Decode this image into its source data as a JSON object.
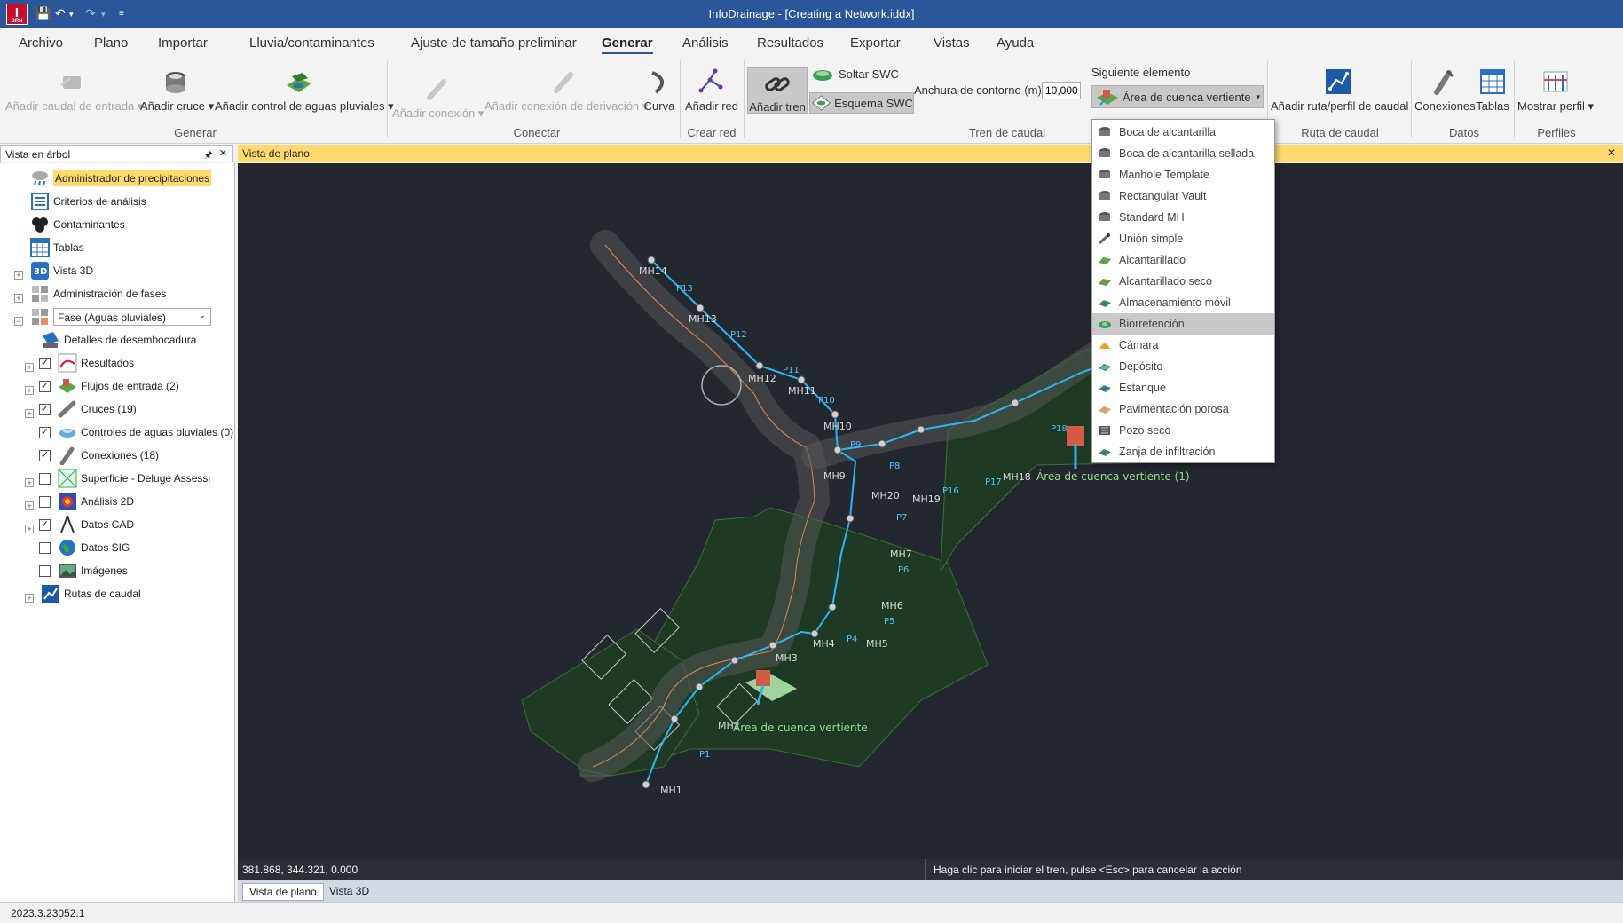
{
  "window": {
    "title": "InfoDrainage - [Creating a Network.iddx]",
    "logo_letter": "I",
    "logo_sub": "DRN"
  },
  "menu": {
    "tabs": [
      "Archivo",
      "Plano",
      "Importar",
      "Lluvia/contaminantes",
      "Ajuste de tamaño preliminar",
      "Generar",
      "Análisis",
      "Resultados",
      "Exportar",
      "Vistas",
      "Ayuda"
    ],
    "active": "Generar"
  },
  "ribbon": {
    "generar": {
      "label": "Generar",
      "add_inflow": "Añadir caudal de entrada",
      "add_junction": "Añadir cruce",
      "add_stormwater_control": "Añadir control de aguas pluviales"
    },
    "conectar": {
      "label": "Conectar",
      "add_connection": "Añadir conexión",
      "add_branch_connection": "Añadir conexión de derivación",
      "curve": "Curva"
    },
    "crear_red": {
      "label": "Crear red",
      "add_network": "Añadir red"
    },
    "tren": {
      "label": "Tren de caudal",
      "add_train": "Añadir tren",
      "drop_swc": "Soltar SWC",
      "swc_schema": "Esquema SWC",
      "contour_width_label": "Anchura de contorno (m)",
      "contour_width_value": "10,000",
      "next_element_label": "Siguiente elemento",
      "next_element_value": "Área de cuenca vertiente"
    },
    "ruta": {
      "label": "Ruta de caudal",
      "add_route": "Añadir ruta/perfil de caudal"
    },
    "datos": {
      "label": "Datos",
      "connections": "Conexiones",
      "tables": "Tablas"
    },
    "perfiles": {
      "label": "Perfiles",
      "show_profile": "Mostrar perfil"
    }
  },
  "dropdown": {
    "items": [
      "Boca de alcantarilla",
      "Boca de alcantarilla sellada",
      "Manhole Template",
      "Rectangular Vault",
      "Standard MH",
      "Unión simple",
      "Alcantarillado",
      "Alcantarillado seco",
      "Almacenamiento móvil",
      "Biorretención",
      "Cámara",
      "Depósito",
      "Estanque",
      "Pavimentación porosa",
      "Pozo seco",
      "Zanja de infiltración"
    ],
    "selected_index": 9
  },
  "tree": {
    "header": "Vista en árbol",
    "pin_glyph": "🖈",
    "close_glyph": "✕",
    "rows": [
      {
        "label": "Administrador de precipitaciones"
      },
      {
        "label": "Criterios de análisis"
      },
      {
        "label": "Contaminantes"
      },
      {
        "label": "Tablas"
      },
      {
        "label": "Vista 3D"
      },
      {
        "label": "Administración de fases"
      },
      {
        "label": "Fase (Aguas pluviales)"
      },
      {
        "label": "Detalles de desembocadura"
      },
      {
        "label": "Resultados"
      },
      {
        "label": "Flujos de entrada (2)"
      },
      {
        "label": "Cruces (19)"
      },
      {
        "label": "Controles de aguas pluviales (0)"
      },
      {
        "label": "Conexiones (18)"
      },
      {
        "label": "Superficie - Deluge Assessment_Pha"
      },
      {
        "label": "Análisis 2D"
      },
      {
        "label": "Datos CAD"
      },
      {
        "label": "Datos SIG"
      },
      {
        "label": "Imágenes"
      },
      {
        "label": "Rutas de caudal"
      }
    ]
  },
  "plan": {
    "header": "Vista de plano",
    "close_glyph": "✕",
    "manholes": [
      "MH14",
      "MH13",
      "MH12",
      "MH11",
      "MH10",
      "MH9",
      "MH20",
      "MH19",
      "MH18",
      "MH7",
      "MH6",
      "MH5",
      "MH4",
      "MH3",
      "MH2",
      "MH1"
    ],
    "pipes": [
      "P13",
      "P12",
      "P11",
      "P10",
      "P9",
      "P8",
      "P16",
      "P17",
      "P18",
      "P7",
      "P6",
      "P5",
      "P4",
      "P1"
    ],
    "catchments": [
      "Área de cuenca vertiente",
      "Área de cuenca vertiente (1)"
    ]
  },
  "status": {
    "coordinates": "381.868, 344.321, 0.000",
    "hint": "Haga clic para iniciar el tren, pulse <Esc> para cancelar la acción"
  },
  "bottom_tabs": [
    "Vista de plano",
    "Vista 3D"
  ],
  "version": "2023.3.23052.1",
  "colors": {
    "titlebar": "#2b579a",
    "plan_bg": "#23272e",
    "highlight": "#ffd96e",
    "pipe": "#29b6f6",
    "catchment": "#1e3a24"
  }
}
